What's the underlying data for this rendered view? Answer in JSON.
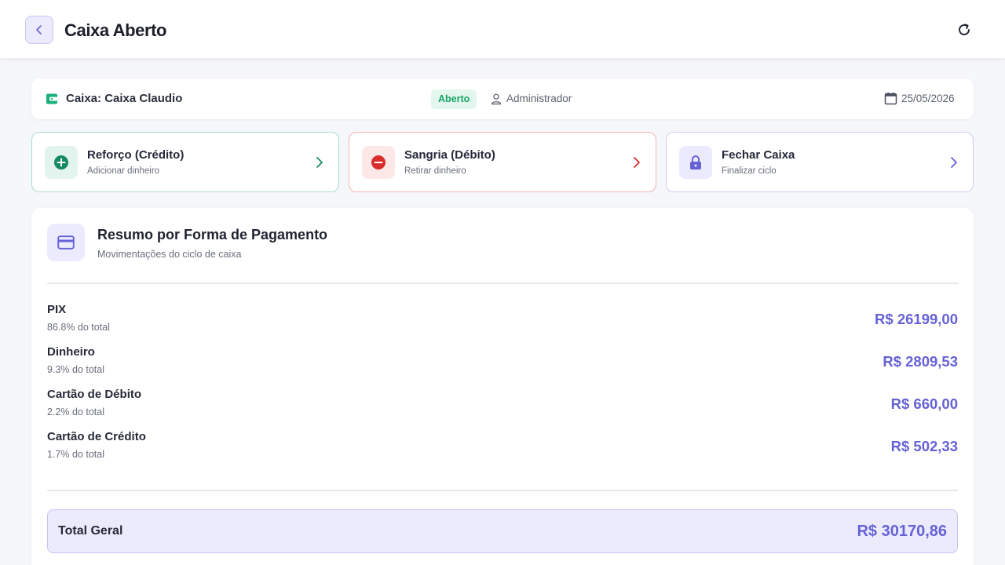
{
  "header": {
    "title": "Caixa Aberto",
    "back_icon": "chevron-left-icon",
    "refresh_icon": "refresh-icon"
  },
  "info_bar": {
    "register_label": "Caixa: Caixa Claudio",
    "status": "Aberto",
    "user": "Administrador",
    "date": "25/05/2026"
  },
  "actions": [
    {
      "title": "Reforço (Crédito)",
      "subtitle": "Adicionar dinheiro",
      "icon": "plus-circle-icon",
      "color": "#168a63"
    },
    {
      "title": "Sangria (Débito)",
      "subtitle": "Retirar dinheiro",
      "icon": "minus-circle-icon",
      "color": "#d92d2d"
    },
    {
      "title": "Fechar Caixa",
      "subtitle": "Finalizar ciclo",
      "icon": "lock-icon",
      "color": "#6562d6"
    }
  ],
  "summary": {
    "title": "Resumo por Forma de Pagamento",
    "subtitle": "Movimentações do ciclo de caixa",
    "icon": "credit-card-icon",
    "rows": [
      {
        "name": "PIX",
        "pct": "86.8% do total",
        "amount": "R$ 26199,00"
      },
      {
        "name": "Dinheiro",
        "pct": "9.3% do total",
        "amount": "R$ 2809,53"
      },
      {
        "name": "Cartão de Débito",
        "pct": "2.2% do total",
        "amount": "R$ 660,00"
      },
      {
        "name": "Cartão de Crédito",
        "pct": "1.7% do total",
        "amount": "R$ 502,33"
      }
    ],
    "total_label": "Total Geral",
    "total_amount": "R$ 30170,86"
  },
  "colors": {
    "accent": "#6562d6",
    "success": "#18a566",
    "danger": "#d92d2d"
  }
}
